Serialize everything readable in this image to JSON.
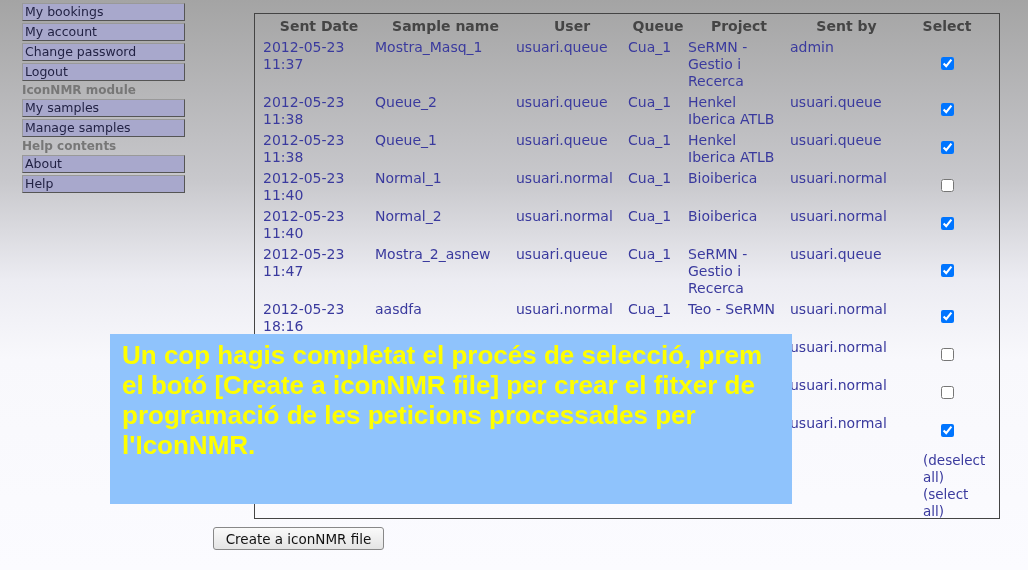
{
  "sidebar": {
    "items": [
      {
        "kind": "link",
        "label": "My bookings"
      },
      {
        "kind": "link",
        "label": "My account"
      },
      {
        "kind": "link",
        "label": "Change password"
      },
      {
        "kind": "link",
        "label": "Logout"
      },
      {
        "kind": "heading",
        "label": "IconNMR module"
      },
      {
        "kind": "link",
        "label": "My samples"
      },
      {
        "kind": "link",
        "label": "Manage samples"
      },
      {
        "kind": "heading",
        "label": "Help contents"
      },
      {
        "kind": "link",
        "label": "About"
      },
      {
        "kind": "link",
        "label": "Help"
      }
    ]
  },
  "table": {
    "columns": [
      "Sent Date",
      "Sample name",
      "User",
      "Queue",
      "Project",
      "Sent by",
      "Select"
    ],
    "rows": [
      {
        "sent_date": "2012-05-23 11:37",
        "sample_name": "Mostra_Masq_1",
        "user": "usuari.queue",
        "queue": "Cua_1",
        "project": "SeRMN - Gestio i Recerca",
        "sent_by": "admin",
        "checked": true
      },
      {
        "sent_date": "2012-05-23 11:38",
        "sample_name": "Queue_2",
        "user": "usuari.queue",
        "queue": "Cua_1",
        "project": "Henkel Iberica ATLB",
        "sent_by": "usuari.queue",
        "checked": true
      },
      {
        "sent_date": "2012-05-23 11:38",
        "sample_name": "Queue_1",
        "user": "usuari.queue",
        "queue": "Cua_1",
        "project": "Henkel Iberica ATLB",
        "sent_by": "usuari.queue",
        "checked": true
      },
      {
        "sent_date": "2012-05-23 11:40",
        "sample_name": "Normal_1",
        "user": "usuari.normal",
        "queue": "Cua_1",
        "project": "Bioiberica",
        "sent_by": "usuari.normal",
        "checked": false
      },
      {
        "sent_date": "2012-05-23 11:40",
        "sample_name": "Normal_2",
        "user": "usuari.normal",
        "queue": "Cua_1",
        "project": "Bioiberica",
        "sent_by": "usuari.normal",
        "checked": true
      },
      {
        "sent_date": "2012-05-23 11:47",
        "sample_name": "Mostra_2_asnew",
        "user": "usuari.queue",
        "queue": "Cua_1",
        "project": "SeRMN - Gestio i Recerca",
        "sent_by": "usuari.queue",
        "checked": true
      },
      {
        "sent_date": "2012-05-23 18:16",
        "sample_name": "aasdfa",
        "user": "usuari.normal",
        "queue": "Cua_1",
        "project": "Teo - SeRMN",
        "sent_by": "usuari.normal",
        "checked": true
      },
      {
        "sent_by": "usuari.normal",
        "checked": false
      },
      {
        "sent_by": "usuari.normal",
        "checked": false
      },
      {
        "sent_by": "usuari.normal",
        "checked": true
      }
    ],
    "deselect_all": "(deselect all)",
    "select_all": "(select all)"
  },
  "create_button": "Create a iconNMR file",
  "caption": "Un cop hagis completat el procés de selecció, prem el botó [Create a iconNMR file] per crear el fitxer de programació de les peticions processades per l'IconNMR."
}
